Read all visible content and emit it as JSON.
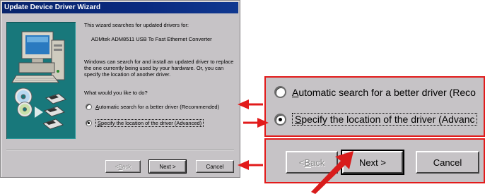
{
  "dialog": {
    "title": "Update Device Driver Wizard",
    "intro": "This wizard searches for updated drivers for:",
    "device_name": "ADMtek ADM8511 USB To Fast Ethernet Converter",
    "description": "Windows can search for and install an updated driver to replace the one currently being used by your hardware. Or, you can specify the location of another driver.",
    "question": "What would you like to do?",
    "options": [
      {
        "mnemonic": "A",
        "rest": "utomatic search for a better driver (Recommended)",
        "selected": false
      },
      {
        "mnemonic": "S",
        "rest": "pecify the location of the driver (Advanced)",
        "selected": true
      }
    ],
    "buttons": {
      "back_mnemonic": "B",
      "back_rest": "ack",
      "back_prefix": "< ",
      "next": "Next >",
      "cancel": "Cancel"
    }
  },
  "zoom_radios": {
    "option1_mnemonic": "A",
    "option1_rest": "utomatic search for a better driver (Reco",
    "option2_mnemonic": "S",
    "option2_rest": "pecify the location of the driver (Advanc"
  },
  "zoom_buttons": {
    "back_prefix": "< ",
    "back_mnemonic": "B",
    "back_rest": "ack",
    "next": "Next >",
    "cancel": "Cancel"
  },
  "colors": {
    "highlight_red": "#e21b1b",
    "titlebar_blue": "#08246b",
    "art_teal": "#18787b",
    "dialog_gray": "#c6c3c6"
  },
  "icons": [
    "computer-icon",
    "cd-disc-icon",
    "floppy-disk-icon",
    "arrow-icon",
    "cursor-arrow-icon"
  ]
}
